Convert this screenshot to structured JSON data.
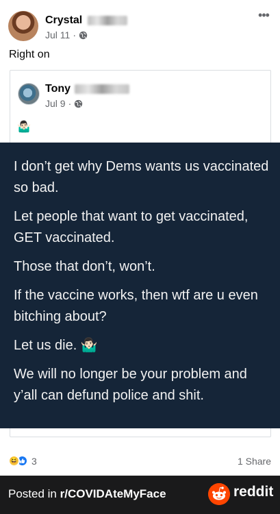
{
  "post": {
    "author_first": "Crystal",
    "date": "Jul 11",
    "separator": "·",
    "more_icon": "more-horizontal-icon",
    "caption": "Right on"
  },
  "shared_post": {
    "author_first": "Tony",
    "date": "Jul 9",
    "separator": "·",
    "emoji": "🤷🏻‍♂️"
  },
  "dark_card": {
    "lines": [
      "I don’t get why Dems wants us vaccinated so bad.",
      "Let people that want to get vaccinated, GET vaccinated.",
      "Those that don’t, won’t.",
      "If the vaccine works, then wtf are u even bitching about?",
      "Let us die. 🤷🏻‍♂️",
      "We will no longer be your problem and y’all can defund police and shit."
    ]
  },
  "engagement": {
    "reaction_count": "3",
    "shares": "1 Share"
  },
  "footer": {
    "prefix": "Posted in ",
    "subreddit": "r/COVIDAteMyFace",
    "brand": "reddit"
  },
  "colors": {
    "card_bg": "#152538",
    "footer_bg": "#1a1a1b",
    "reddit_orange": "#ff4500",
    "meta_gray": "#65676b"
  }
}
